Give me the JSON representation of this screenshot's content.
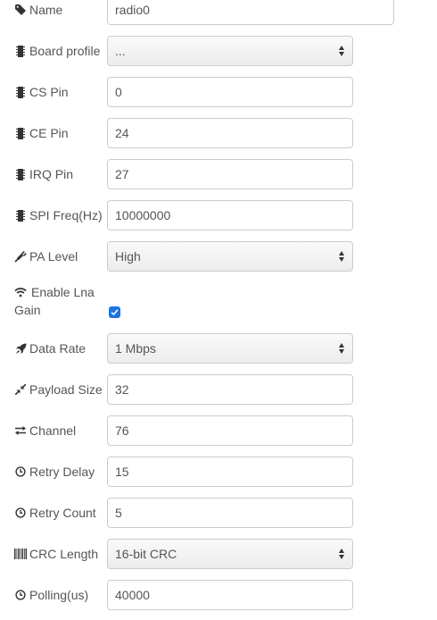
{
  "fields": {
    "name": {
      "label": "Name",
      "value": "radio0"
    },
    "board_profile": {
      "label": "Board profile",
      "value": "..."
    },
    "cs_pin": {
      "label": "CS Pin",
      "value": "0"
    },
    "ce_pin": {
      "label": "CE Pin",
      "value": "24"
    },
    "irq_pin": {
      "label": "IRQ Pin",
      "value": "27"
    },
    "spi_freq": {
      "label": "SPI Freq(Hz)",
      "value": "10000000"
    },
    "pa_level": {
      "label": "PA Level",
      "value": "High"
    },
    "enable_lna_gain": {
      "label_line1": "Enable Lna",
      "label_line2": "Gain",
      "checked": true
    },
    "data_rate": {
      "label": "Data Rate",
      "value": "1 Mbps"
    },
    "payload_size": {
      "label": "Payload Size",
      "value": "32"
    },
    "channel": {
      "label": "Channel",
      "value": "76"
    },
    "retry_delay": {
      "label": "Retry Delay",
      "value": "15"
    },
    "retry_count": {
      "label": "Retry Count",
      "value": "5"
    },
    "crc_length": {
      "label": "CRC Length",
      "value": "16-bit CRC"
    },
    "polling": {
      "label": "Polling(us)",
      "value": "40000"
    }
  },
  "icons": {
    "name": "tag-icon",
    "board_profile": "microchip-icon",
    "cs_pin": "microchip-icon",
    "ce_pin": "microchip-icon",
    "irq_pin": "microchip-icon",
    "spi_freq": "microchip-icon",
    "pa_level": "plug-icon",
    "enable_lna_gain": "wifi-icon",
    "data_rate": "rocket-icon",
    "payload_size": "compress-icon",
    "channel": "exchange-icon",
    "retry_delay": "clock-icon",
    "retry_count": "clock-icon",
    "crc_length": "barcode-icon",
    "polling": "clock-icon"
  },
  "colors": {
    "checkbox": "#1a73e8",
    "text": "#555555",
    "border": "#cccccc"
  }
}
